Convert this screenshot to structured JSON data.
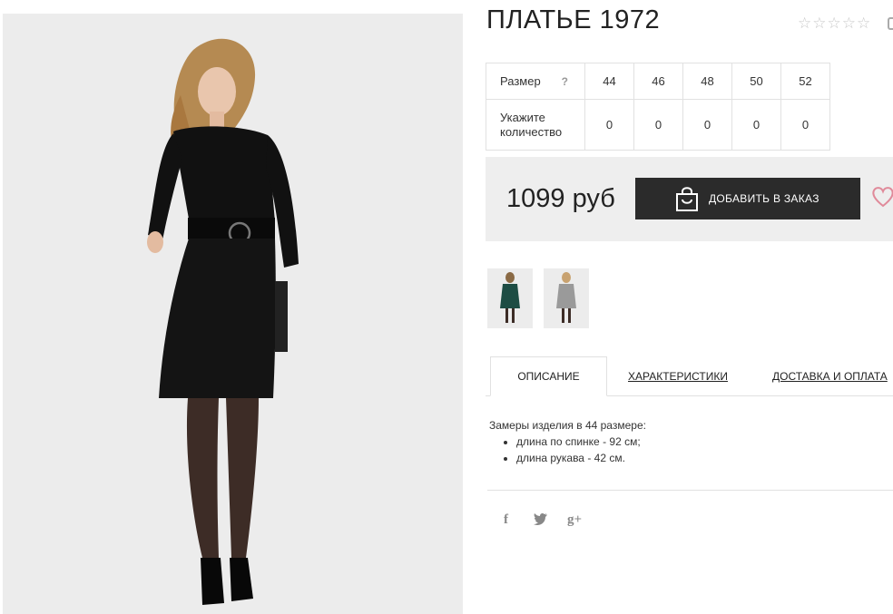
{
  "product": {
    "title": "ПЛАТЬЕ 1972",
    "rating_icons": [
      "star-empty",
      "star-empty",
      "star-empty",
      "star-empty",
      "star-empty"
    ],
    "sizes_table": {
      "size_label": "Размер",
      "help_mark": "?",
      "qty_label": "Укажите количество",
      "sizes": [
        "44",
        "46",
        "48",
        "50",
        "52"
      ],
      "quantities": [
        "0",
        "0",
        "0",
        "0",
        "0"
      ]
    },
    "price": "1099 руб",
    "add_button_label": "ДОБАВИТЬ В ЗАКАЗ",
    "tabs": [
      {
        "label": "ОПИСАНИЕ",
        "active": true
      },
      {
        "label": "ХАРАКТЕРИСТИКИ",
        "active": false
      },
      {
        "label": "ДОСТАВКА И ОПЛАТА",
        "active": false
      }
    ],
    "description": {
      "intro": "Замеры изделия в 44 размере:",
      "items": [
        "длина по спинке - 92 см;",
        "длина рукава - 42 см."
      ]
    },
    "social": {
      "facebook": "f",
      "twitter": "t",
      "googleplus": "g+"
    }
  },
  "colors": {
    "button_bg": "#2b2b2b",
    "price_bar_bg": "#eeeeee",
    "heart": "#e08a9a",
    "dress_main": "#111111",
    "dress_thumb_green": "#1d4d44",
    "dress_thumb_grey": "#9a9a9a"
  }
}
